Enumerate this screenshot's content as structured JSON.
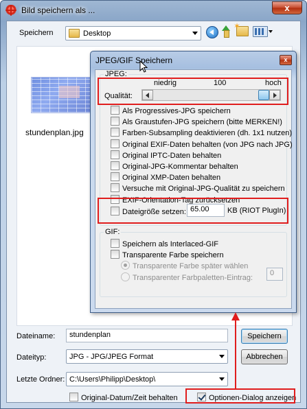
{
  "window": {
    "title": "Bild speichern als ...",
    "close_label": "x"
  },
  "toolbar": {
    "save_in_label": "Speichern",
    "location": "Desktop"
  },
  "files": [
    {
      "name": "stundenplan.jpg"
    }
  ],
  "bottom": {
    "filename_label": "Dateiname:",
    "filename_value": "stundenplan",
    "filetype_label": "Dateityp:",
    "filetype_value": "JPG - JPG/JPEG Format",
    "lastfolder_label": "Letzte Ordner:",
    "lastfolder_value": "C:\\Users\\Philipp\\Desktop\\",
    "save_button": "Speichern",
    "cancel_button": "Abbrechen",
    "original_date_label": "Original-Datum/Zeit behalten",
    "original_date_checked": false,
    "options_dialog_label": "Optionen-Dialog anzeigen",
    "options_dialog_checked": true
  },
  "jpg_dialog": {
    "title": "JPEG/GIF Speichern",
    "close_label": "x",
    "jpeg_group_label": "JPEG:",
    "quality": {
      "label": "Qualität:",
      "low": "niedrig",
      "mid": "100",
      "high": "hoch",
      "value_fraction": 1.0
    },
    "options": [
      {
        "label": "Als Progressives-JPG speichern",
        "checked": false
      },
      {
        "label": "Als Graustufen-JPG speichern (bitte MERKEN!)",
        "checked": false
      },
      {
        "label": "Farben-Subsampling deaktivieren (dh. 1x1 nutzen)",
        "checked": false
      },
      {
        "label": "Original EXIF-Daten behalten (von JPG nach JPG)",
        "checked": false
      },
      {
        "label": "Original IPTC-Daten behalten",
        "checked": false
      },
      {
        "label": "Original-JPG-Kommentar behalten",
        "checked": false
      },
      {
        "label": "Original XMP-Daten behalten",
        "checked": false
      },
      {
        "label": "Versuche mit Original-JPG-Qualität zu speichern",
        "checked": false
      },
      {
        "label": "EXIF-Orientation-Tag zurücksetzen",
        "checked": false
      }
    ],
    "filesize": {
      "label": "Dateigröße setzen:",
      "value": "65.00",
      "unit": "KB (RIOT PlugIn)",
      "checked": false
    },
    "gif_group_label": "GIF:",
    "gif_options": [
      {
        "label": "Speichern als Interlaced-GIF",
        "checked": false
      },
      {
        "label": "Transparente Farbe speichern",
        "checked": false
      }
    ],
    "gif_radios": [
      {
        "label": "Transparente Farbe später wählen",
        "checked": true
      },
      {
        "label": "Transparenter Farbpaletten-Eintrag:",
        "checked": false
      }
    ],
    "palette_index": "0"
  }
}
